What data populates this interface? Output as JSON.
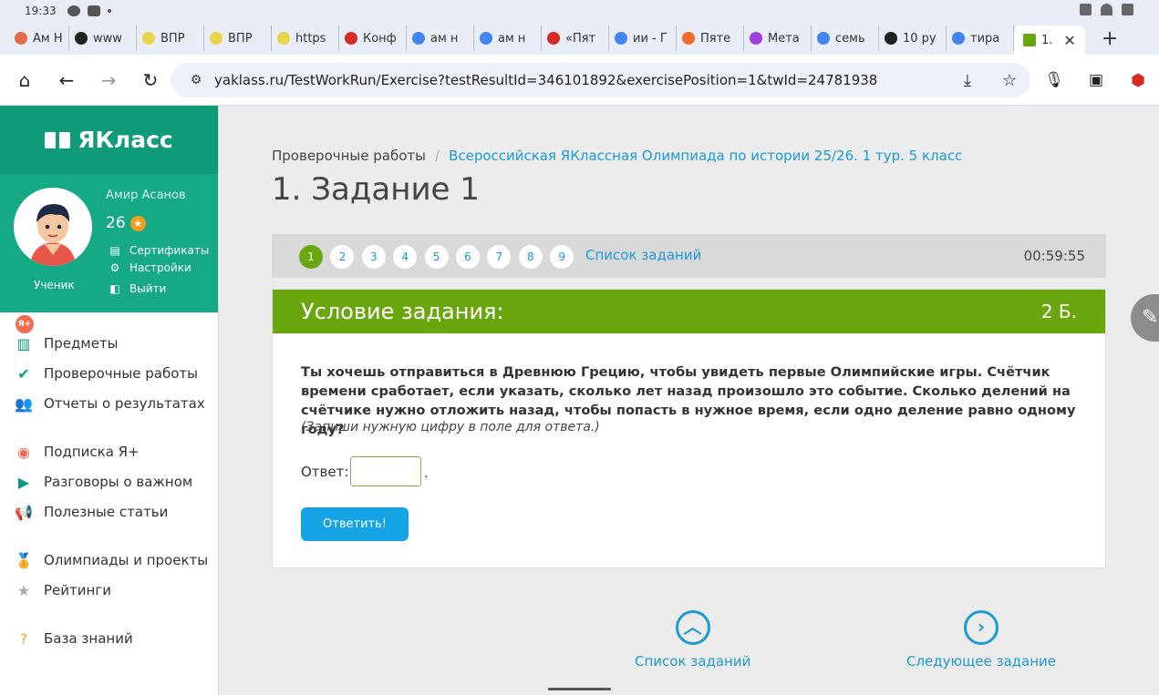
{
  "statusbar": {
    "time": "19:33"
  },
  "tabs": [
    {
      "label": "Ам Н",
      "fav_color": "#e56b4a"
    },
    {
      "label": "www",
      "fav_color": "#222222"
    },
    {
      "label": "ВПР",
      "fav_color": "#e9d44a"
    },
    {
      "label": "ВПР",
      "fav_color": "#e9d44a"
    },
    {
      "label": "https",
      "fav_color": "#e9d44a"
    },
    {
      "label": "Конф",
      "fav_color": "#d62b20"
    },
    {
      "label": "ам н",
      "fav_color": "#4285f4"
    },
    {
      "label": "ам н",
      "fav_color": "#4285f4"
    },
    {
      "label": "«Пят",
      "fav_color": "#d62b20"
    },
    {
      "label": "ии - Г",
      "fav_color": "#4285f4"
    },
    {
      "label": "Пяте",
      "fav_color": "#f26b2a"
    },
    {
      "label": "Мета",
      "fav_color": "#a33de0"
    },
    {
      "label": "семь",
      "fav_color": "#4285f4"
    },
    {
      "label": "10 ру",
      "fav_color": "#222222"
    },
    {
      "label": "тира",
      "fav_color": "#4285f4"
    }
  ],
  "active_tab": {
    "label": "1.",
    "fav_color": "#6aa70f"
  },
  "address": {
    "url": "yaklass.ru/TestWorkRun/Exercise?testResultId=346101892&exercisePosition=1&twId=24781938"
  },
  "sidebar": {
    "brand": "ЯКласс",
    "user_name": "Амир Асанов",
    "points": "26",
    "role": "Ученик",
    "badge": "Я+",
    "links": [
      {
        "label": "Сертификаты",
        "icon": "certificate-icon"
      },
      {
        "label": "Настройки",
        "icon": "gear-icon"
      },
      {
        "label": "Выйти",
        "icon": "logout-icon"
      }
    ],
    "nav": [
      {
        "label": "Предметы",
        "icon": "book-icon"
      },
      {
        "label": "Проверочные работы",
        "icon": "check-circle-icon"
      },
      {
        "label": "Отчеты о результатах",
        "icon": "users-icon"
      },
      {
        "label": "Подписка Я+",
        "icon": "subscription-icon"
      },
      {
        "label": "Разговоры о важном",
        "icon": "play-icon"
      },
      {
        "label": "Полезные статьи",
        "icon": "megaphone-icon"
      },
      {
        "label": "Олимпиады и проекты",
        "icon": "medal-icon"
      },
      {
        "label": "Рейтинги",
        "icon": "star-icon"
      },
      {
        "label": "База знаний",
        "icon": "question-icon"
      }
    ]
  },
  "breadcrumb": {
    "root": "Проверочные работы",
    "current": "Всероссийская ЯКлассная Олимпиада по истории 25/26. 1 тур. 5 класс"
  },
  "page_title": "1. Задание 1",
  "question_nav": {
    "numbers": [
      "1",
      "2",
      "3",
      "4",
      "5",
      "6",
      "7",
      "8",
      "9"
    ],
    "current": "1",
    "list_link": "Список заданий",
    "timer": "00:59:55"
  },
  "task": {
    "header": "Условие задания:",
    "points": "2 Б.",
    "text": "Ты хочешь отправиться в Древнюю Грецию, чтобы увидеть первые Олимпийские игры. Счётчик времени сработает, если указать, сколько лет назад произошло это событие. Сколько делений на счётчике нужно отложить назад, чтобы попасть в нужное время, если одно деление равно одному году?",
    "hint": "(Запиши нужную цифру в поле для ответа.)",
    "answer_label": "Ответ:",
    "answer_value": "",
    "answer_suffix": ".",
    "submit_label": "Ответить!"
  },
  "bottom_nav": {
    "list_label": "Список заданий",
    "next_label": "Следующее задание"
  },
  "colors": {
    "brand_green": "#0e9b7a",
    "profile_green": "#15a986",
    "task_green": "#6aa70f",
    "link_blue": "#1c9ad6",
    "button_blue": "#14a3e4"
  }
}
